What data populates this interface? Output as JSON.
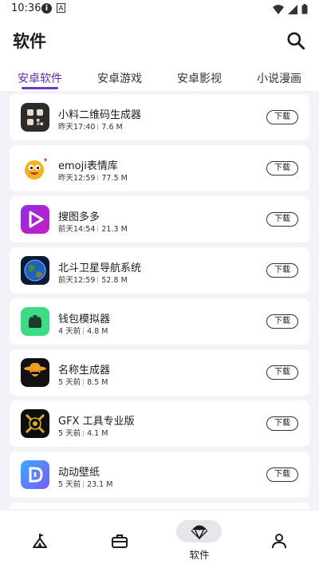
{
  "status": {
    "time": "10:36",
    "info_glyph": "i",
    "a_glyph": "A"
  },
  "appbar": {
    "title": "软件",
    "search_icon": "search-icon"
  },
  "tabs": [
    {
      "label": "安卓软件",
      "active": true
    },
    {
      "label": "安卓游戏",
      "active": false
    },
    {
      "label": "安卓影视",
      "active": false
    },
    {
      "label": "小说漫画",
      "active": false
    }
  ],
  "apps": [
    {
      "name": "小料二维码生成器",
      "time": "昨天17:40",
      "size": "7.6 M",
      "button": "下载",
      "icon": "qr-code-app-icon"
    },
    {
      "name": "emoji表情库",
      "time": "昨天12:59",
      "size": "77.5 M",
      "button": "下载",
      "icon": "emoji-face-app-icon"
    },
    {
      "name": "搜图多多",
      "time": "前天14:54",
      "size": "21.3 M",
      "button": "下载",
      "icon": "play-gradient-app-icon"
    },
    {
      "name": "北斗卫星导航系统",
      "time": "前天12:59",
      "size": "52.8 M",
      "button": "下载",
      "icon": "earth-globe-app-icon"
    },
    {
      "name": "钱包模拟器",
      "time": "4 天前",
      "size": "4.8 M",
      "button": "下载",
      "icon": "android-robot-app-icon"
    },
    {
      "name": "名称生成器",
      "time": "5 天前",
      "size": "8.5 M",
      "button": "下载",
      "icon": "cowboy-hat-app-icon"
    },
    {
      "name": "GFX 工具专业版",
      "time": "5 天前",
      "size": "4.1 M",
      "button": "下载",
      "icon": "gfx-badge-app-icon"
    },
    {
      "name": "动动壁纸",
      "time": "5 天前",
      "size": "23.1 M",
      "button": "下载",
      "icon": "wallpaper-d-app-icon"
    }
  ],
  "bottom_nav": [
    {
      "icon": "home-tent-icon",
      "label": ""
    },
    {
      "icon": "briefcase-icon",
      "label": ""
    },
    {
      "icon": "parachute-icon",
      "label": "软件",
      "active": true
    },
    {
      "icon": "profile-icon",
      "label": ""
    }
  ],
  "colors": {
    "accent": "#6a3cc2",
    "background": "#f2f2f7",
    "card": "#ffffff"
  }
}
